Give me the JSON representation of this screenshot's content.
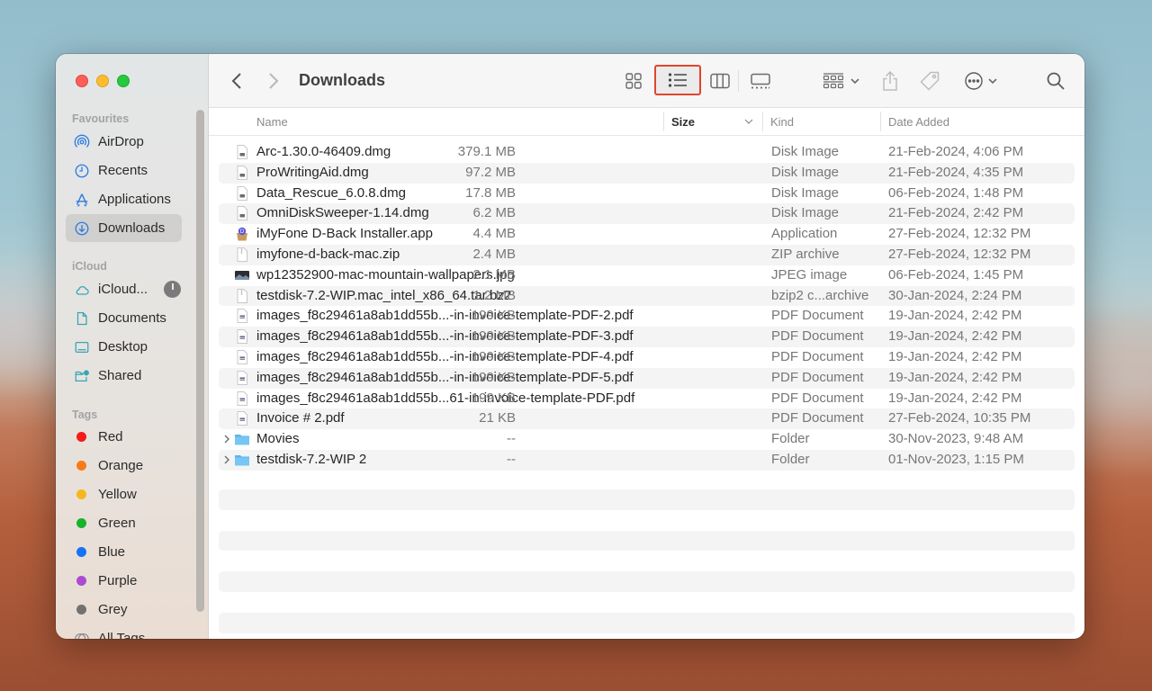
{
  "window": {
    "title": "Downloads",
    "traffic_lights": [
      "close",
      "minimize",
      "maximize"
    ]
  },
  "sidebar": {
    "sections": [
      {
        "title": "Favourites",
        "items": [
          {
            "label": "AirDrop",
            "icon": "airdrop-icon",
            "active": false
          },
          {
            "label": "Recents",
            "icon": "clock-icon",
            "active": false
          },
          {
            "label": "Applications",
            "icon": "applications-icon",
            "active": false
          },
          {
            "label": "Downloads",
            "icon": "download-icon",
            "active": true
          }
        ]
      },
      {
        "title": "iCloud",
        "items": [
          {
            "label": "iCloud...",
            "icon": "cloud-icon",
            "has_progress": true
          },
          {
            "label": "Documents",
            "icon": "document-icon"
          },
          {
            "label": "Desktop",
            "icon": "desktop-icon"
          },
          {
            "label": "Shared",
            "icon": "shared-folder-icon"
          }
        ]
      },
      {
        "title": "Tags",
        "items": [
          {
            "label": "Red",
            "color": "#f31b1b"
          },
          {
            "label": "Orange",
            "color": "#f77b18"
          },
          {
            "label": "Yellow",
            "color": "#f6b71c"
          },
          {
            "label": "Green",
            "color": "#19b22b"
          },
          {
            "label": "Blue",
            "color": "#1573f5"
          },
          {
            "label": "Purple",
            "color": "#ac4bd2"
          },
          {
            "label": "Grey",
            "color": "#727272"
          },
          {
            "label": "All Tags...",
            "icon": "all-tags-icon"
          }
        ]
      }
    ]
  },
  "toolbar": {
    "back": "chevron-left-icon",
    "forward": "chevron-right-icon",
    "views": [
      {
        "name": "icon-view",
        "selected": false
      },
      {
        "name": "list-view",
        "selected": true
      },
      {
        "name": "column-view",
        "selected": false
      },
      {
        "name": "gallery-view",
        "selected": false
      }
    ],
    "actions": [
      "group-by",
      "share",
      "tags",
      "more-actions",
      "search"
    ],
    "accent_highlight": "#e0452d"
  },
  "table": {
    "columns": [
      {
        "label": "Name"
      },
      {
        "label": "Size",
        "sorted": true,
        "sort_direction": "descending"
      },
      {
        "label": "Kind"
      },
      {
        "label": "Date Added"
      }
    ],
    "rows": [
      {
        "name": "Arc-1.30.0-46409.dmg",
        "size": "379.1 MB",
        "kind": "Disk Image",
        "date": "21-Feb-2024, 4:06 PM",
        "type": "dmg"
      },
      {
        "name": "ProWritingAid.dmg",
        "size": "97.2 MB",
        "kind": "Disk Image",
        "date": "21-Feb-2024, 4:35 PM",
        "type": "dmg"
      },
      {
        "name": "Data_Rescue_6.0.8.dmg",
        "size": "17.8 MB",
        "kind": "Disk Image",
        "date": "06-Feb-2024, 1:48 PM",
        "type": "dmg"
      },
      {
        "name": "OmniDiskSweeper-1.14.dmg",
        "size": "6.2 MB",
        "kind": "Disk Image",
        "date": "21-Feb-2024, 2:42 PM",
        "type": "dmg"
      },
      {
        "name": "iMyFone D-Back Installer.app",
        "size": "4.4 MB",
        "kind": "Application",
        "date": "27-Feb-2024, 12:32 PM",
        "type": "app"
      },
      {
        "name": "imyfone-d-back-mac.zip",
        "size": "2.4 MB",
        "kind": "ZIP archive",
        "date": "27-Feb-2024, 12:32 PM",
        "type": "archive"
      },
      {
        "name": "wp12352900-mac-mountain-wallpapers.jpg",
        "size": "2.1 MB",
        "kind": "JPEG image",
        "date": "06-Feb-2024, 1:45 PM",
        "type": "image"
      },
      {
        "name": "testdisk-7.2-WIP.mac_intel_x86_64.tar.bz2",
        "size": "1.2 MB",
        "kind": "bzip2 c...archive",
        "date": "30-Jan-2024, 2:24 PM",
        "type": "archive"
      },
      {
        "name": "images_f8c29461a8ab1dd55b...-in-invoice-template-PDF-2.pdf",
        "size": "199 KB",
        "kind": "PDF Document",
        "date": "19-Jan-2024, 2:42 PM",
        "type": "pdf"
      },
      {
        "name": "images_f8c29461a8ab1dd55b...-in-invoice-template-PDF-3.pdf",
        "size": "199 KB",
        "kind": "PDF Document",
        "date": "19-Jan-2024, 2:42 PM",
        "type": "pdf"
      },
      {
        "name": "images_f8c29461a8ab1dd55b...-in-invoice-template-PDF-4.pdf",
        "size": "199 KB",
        "kind": "PDF Document",
        "date": "19-Jan-2024, 2:42 PM",
        "type": "pdf"
      },
      {
        "name": "images_f8c29461a8ab1dd55b...-in-invoice-template-PDF-5.pdf",
        "size": "199 KB",
        "kind": "PDF Document",
        "date": "19-Jan-2024, 2:42 PM",
        "type": "pdf"
      },
      {
        "name": "images_f8c29461a8ab1dd55b...61-in-invoice-template-PDF.pdf",
        "size": "199 KB",
        "kind": "PDF Document",
        "date": "19-Jan-2024, 2:42 PM",
        "type": "pdf"
      },
      {
        "name": "Invoice # 2.pdf",
        "size": "21 KB",
        "kind": "PDF Document",
        "date": "27-Feb-2024, 10:35 PM",
        "type": "pdf"
      },
      {
        "name": "Movies",
        "size": "--",
        "kind": "Folder",
        "date": "30-Nov-2023, 9:48 AM",
        "type": "folder"
      },
      {
        "name": "testdisk-7.2-WIP 2",
        "size": "--",
        "kind": "Folder",
        "date": "01-Nov-2023, 1:15 PM",
        "type": "folder"
      }
    ]
  }
}
